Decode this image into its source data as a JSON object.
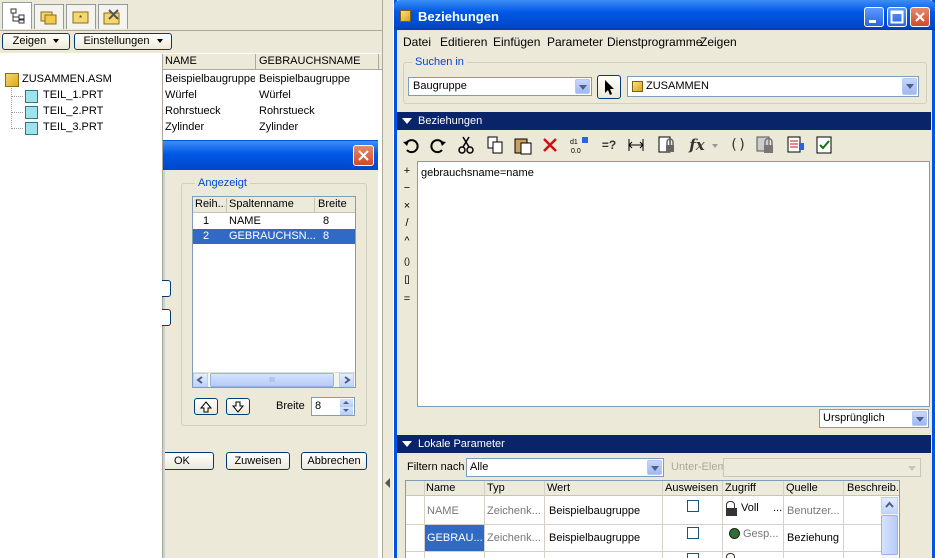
{
  "left_panel": {
    "zeigen_label": "Zeigen",
    "einstellungen_label": "Einstellungen",
    "tree": [
      {
        "label": "ZUSAMMEN.ASM"
      },
      {
        "label": "TEIL_1.PRT"
      },
      {
        "label": "TEIL_2.PRT"
      },
      {
        "label": "TEIL_3.PRT"
      }
    ],
    "columns": [
      "NAME",
      "GEBRAUCHSNAME"
    ],
    "rows": [
      [
        "Beispielbaugruppe",
        "Beispielbaugruppe"
      ],
      [
        "Würfel",
        "Würfel"
      ],
      [
        "Rohrstueck",
        "Rohrstueck"
      ],
      [
        "Zylinder",
        "Zylinder"
      ]
    ]
  },
  "column_dialog": {
    "group_label": "Angezeigt",
    "headers": [
      "Reih...",
      "Spaltenname",
      "Breite"
    ],
    "rows": [
      {
        "nr": "1",
        "name": "NAME",
        "width": "8"
      },
      {
        "nr": "2",
        "name": "GEBRAUCHSN...",
        "width": "8"
      }
    ],
    "scroll_thumb": "III",
    "breite_label": "Breite",
    "breite_value": "8",
    "ok_label": "OK",
    "zuweisen_label": "Zuweisen",
    "abbrechen_label": "Abbrechen"
  },
  "window": {
    "title": "Beziehungen",
    "menu": [
      "Datei",
      "Editieren",
      "Einfügen",
      "Parameter",
      "Dienstprogramme",
      "Zeigen"
    ],
    "suchen_in_label": "Suchen in",
    "baugruppe_value": "Baugruppe",
    "zusammen_value": "ZUSAMMEN",
    "section_beziehungen": "Beziehungen",
    "side_ops": [
      "+",
      "−",
      "×",
      "/",
      "^",
      "()",
      "[]",
      "="
    ],
    "editor_text": "gebrauchsname=name",
    "ursprunglich_value": "Ursprünglich",
    "section_lokale": "Lokale Parameter",
    "filtern_label": "Filtern nach",
    "filter_value": "Alle",
    "unter_elem_label": "Unter-Elem",
    "param_headers": [
      "Name",
      "Typ",
      "Wert",
      "Ausweisen",
      "Zugriff",
      "Quelle",
      "Beschreib."
    ],
    "param_rows": [
      {
        "name": "NAME",
        "typ": "Zeichenk...",
        "wert": "Beispielbaugruppe",
        "zugriff": "Voll",
        "more": "...",
        "quelle": "Benutzer..."
      },
      {
        "name": "GEBRAU...",
        "typ": "Zeichenk...",
        "wert": "Beispielbaugruppe",
        "zugriff": "Gesp...",
        "more": "",
        "quelle": "Beziehung"
      }
    ]
  }
}
